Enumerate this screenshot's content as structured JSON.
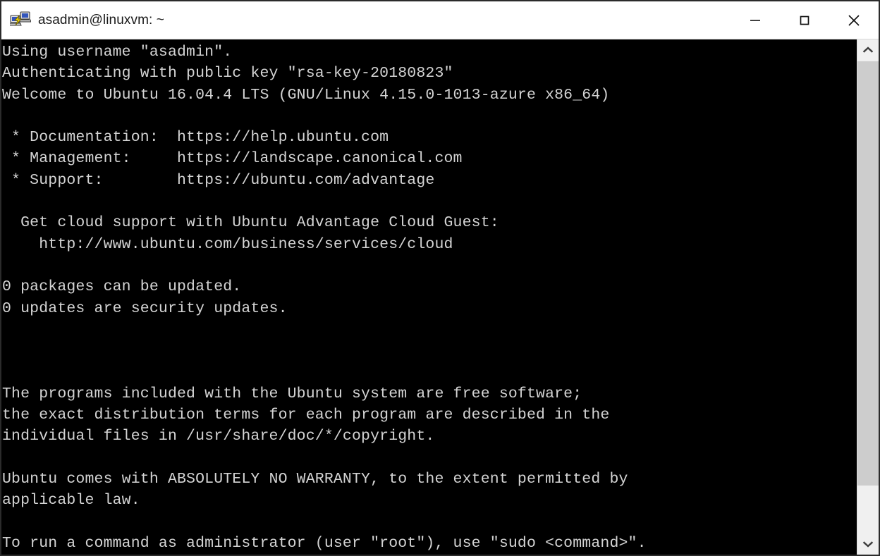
{
  "window": {
    "title": "asadmin@linuxvm: ~",
    "icon": "putty-icon",
    "background_color": "#000000",
    "titlebar_color": "#ffffff",
    "controls": {
      "minimize": "Minimize",
      "maximize": "Maximize",
      "close": "Close"
    }
  },
  "terminal": {
    "text_color": "#d4d4d4",
    "background_color": "#000000",
    "content": "Using username \"asadmin\".\nAuthenticating with public key \"rsa-key-20180823\"\nWelcome to Ubuntu 16.04.4 LTS (GNU/Linux 4.15.0-1013-azure x86_64)\n\n * Documentation:  https://help.ubuntu.com\n * Management:     https://landscape.canonical.com\n * Support:        https://ubuntu.com/advantage\n\n  Get cloud support with Ubuntu Advantage Cloud Guest:\n    http://www.ubuntu.com/business/services/cloud\n\n0 packages can be updated.\n0 updates are security updates.\n\n\n\nThe programs included with the Ubuntu system are free software;\nthe exact distribution terms for each program are described in the\nindividual files in /usr/share/doc/*/copyright.\n\nUbuntu comes with ABSOLUTELY NO WARRANTY, to the extent permitted by\napplicable law.\n\nTo run a command as administrator (user \"root\"), use \"sudo <command>\".",
    "lines": [
      "Using username \"asadmin\".",
      "Authenticating with public key \"rsa-key-20180823\"",
      "Welcome to Ubuntu 16.04.4 LTS (GNU/Linux 4.15.0-1013-azure x86_64)",
      "",
      " * Documentation:  https://help.ubuntu.com",
      " * Management:     https://landscape.canonical.com",
      " * Support:        https://ubuntu.com/advantage",
      "",
      "  Get cloud support with Ubuntu Advantage Cloud Guest:",
      "    http://www.ubuntu.com/business/services/cloud",
      "",
      "0 packages can be updated.",
      "0 updates are security updates.",
      "",
      "",
      "",
      "The programs included with the Ubuntu system are free software;",
      "the exact distribution terms for each program are described in the",
      "individual files in /usr/share/doc/*/copyright.",
      "",
      "Ubuntu comes with ABSOLUTELY NO WARRANTY, to the extent permitted by",
      "applicable law.",
      "",
      "To run a command as administrator (user \"root\"), use \"sudo <command>\"."
    ]
  },
  "scrollbar": {
    "up_arrow": "scroll-up",
    "down_arrow": "scroll-down",
    "thumb": "scroll-thumb",
    "track_color": "#f0f0f0",
    "thumb_color": "#cdcdcd"
  }
}
